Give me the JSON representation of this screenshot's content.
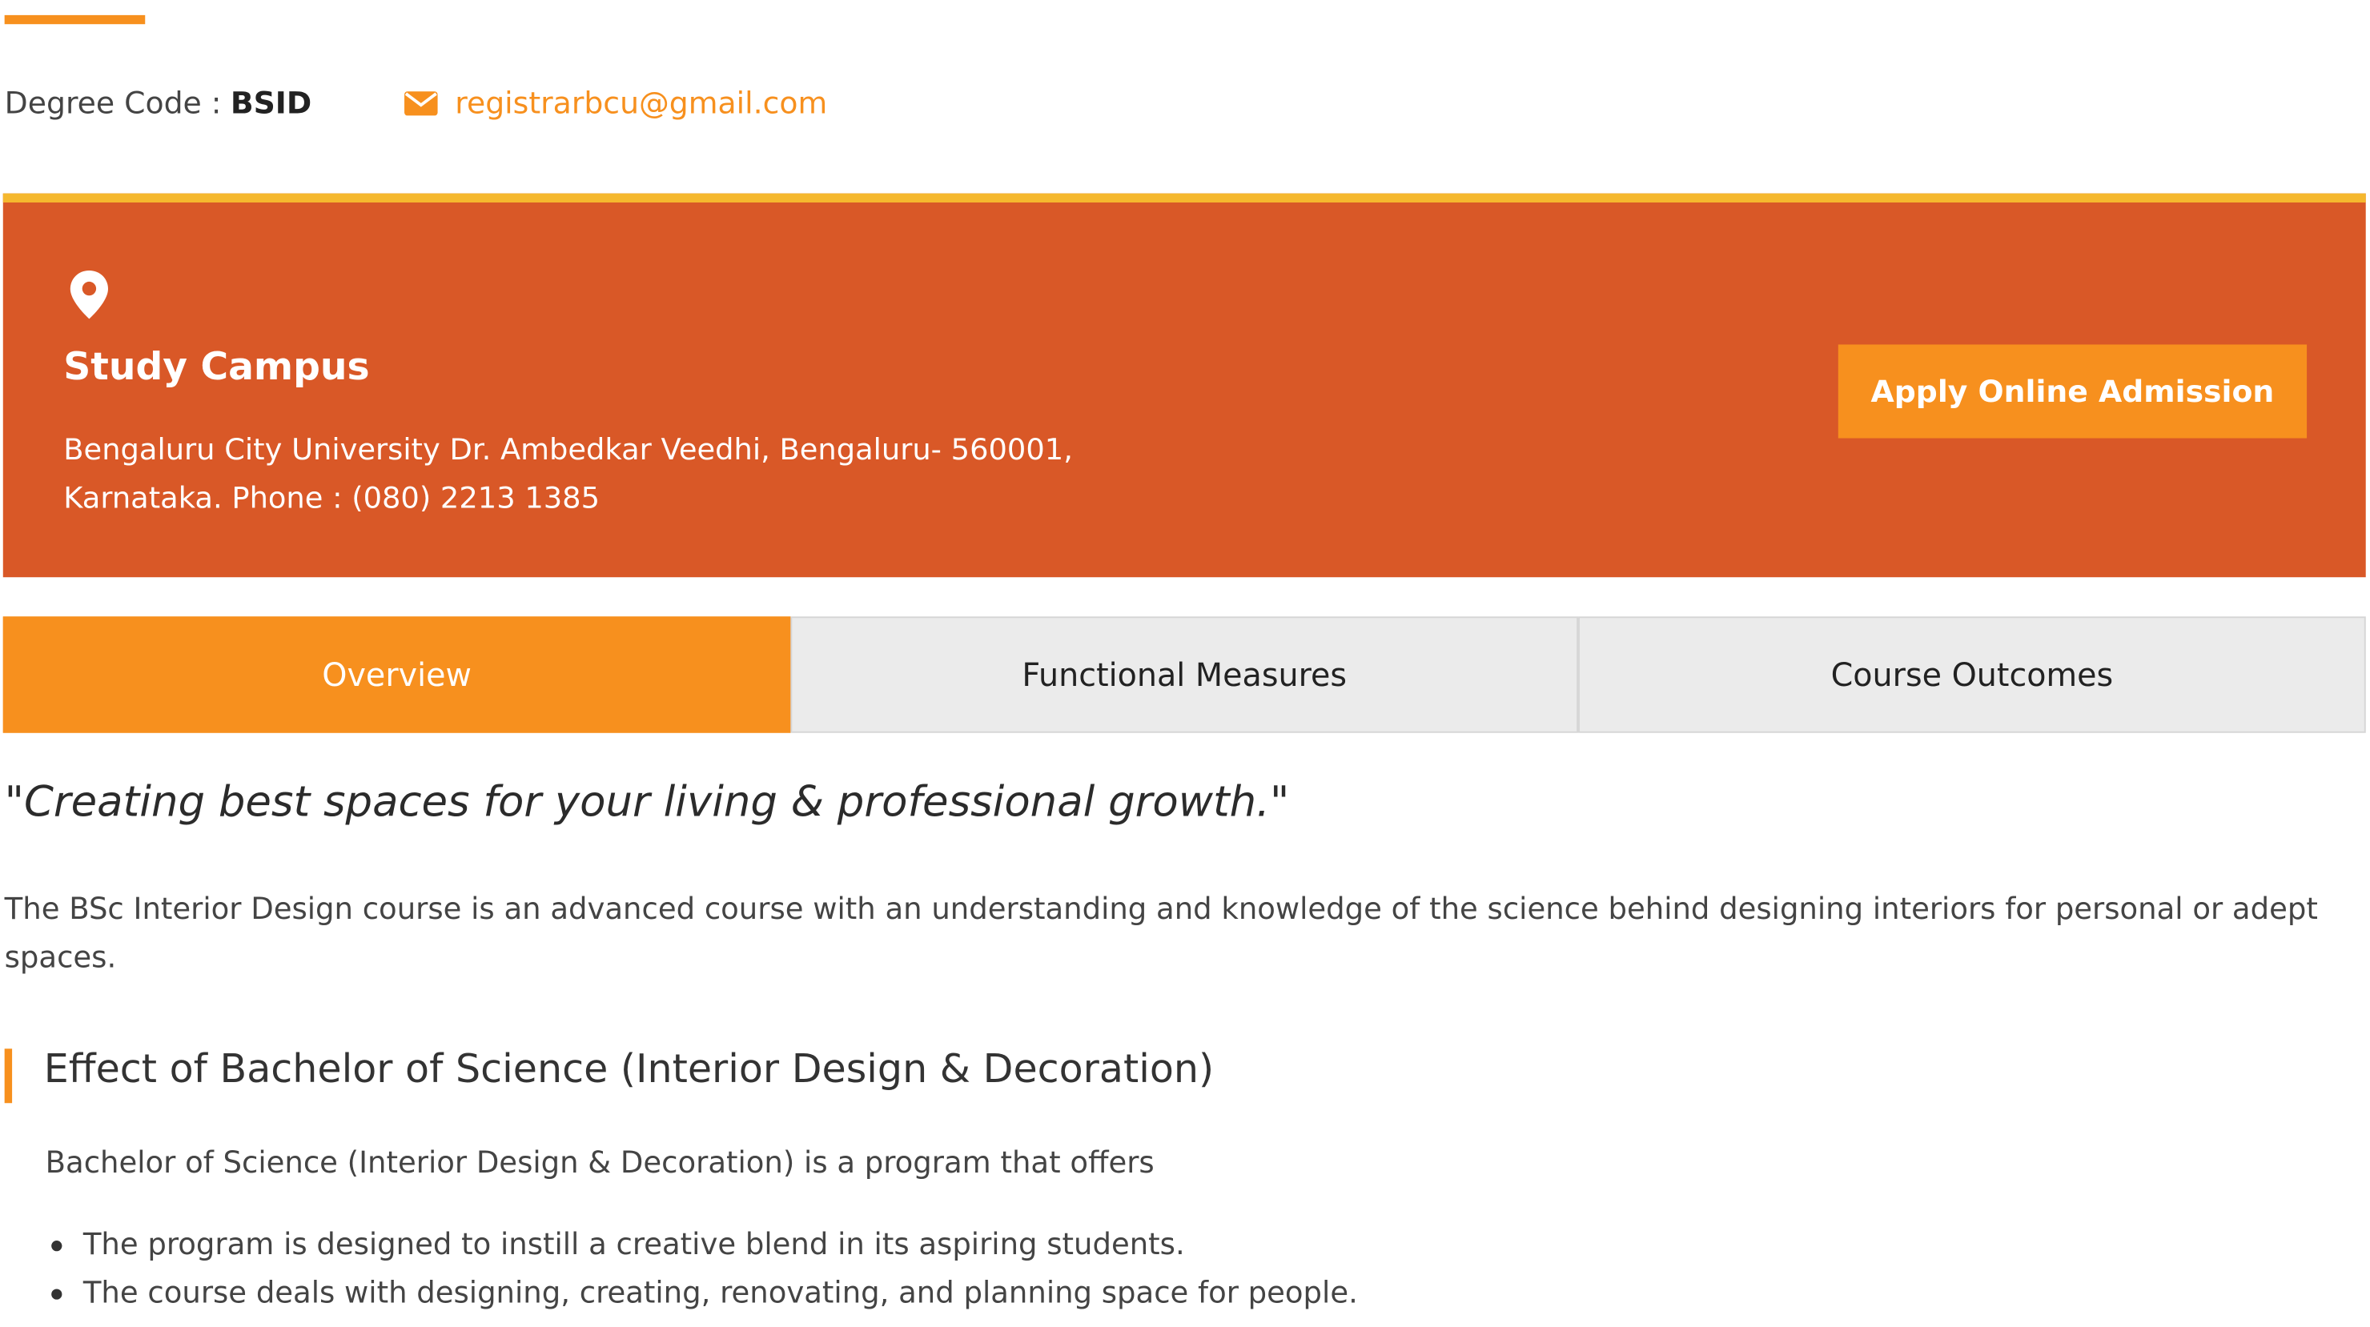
{
  "header": {
    "degree_label": "Degree Code :",
    "degree_code": "BSID",
    "email": "registrarbcu@gmail.com"
  },
  "campus": {
    "icon": "location-pin-icon",
    "title": "Study Campus",
    "address": "Bengaluru City University Dr. Ambedkar Veedhi, Bengaluru- 560001, Karnataka. Phone : (080) 2213 1385",
    "apply_label": "Apply Online Admission"
  },
  "tabs": [
    {
      "label": "Overview",
      "active": true
    },
    {
      "label": "Functional Measures",
      "active": false
    },
    {
      "label": "Course Outcomes",
      "active": false
    }
  ],
  "overview": {
    "tagline": "\"Creating best spaces for your living & professional growth.\"",
    "intro": "The BSc Interior Design course is an advanced course with an understanding and knowledge of the science behind designing interiors for personal or adept spaces.",
    "section_heading": "Effect of Bachelor of Science (Interior Design & Decoration)",
    "section_lead": "Bachelor of Science (Interior Design & Decoration) is a program that offers",
    "bullets": [
      "The program is designed to instill a creative blend in its aspiring students.",
      "The course deals with designing, creating, renovating, and planning space for people."
    ]
  },
  "colors": {
    "accent": "#f7901e",
    "panel": "#d95827",
    "panel_top_border": "#f5b82e",
    "tab_inactive": "#ebebeb"
  }
}
